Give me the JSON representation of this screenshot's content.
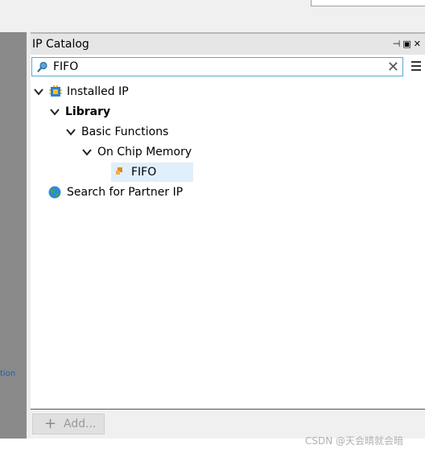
{
  "panel": {
    "title": "IP Catalog"
  },
  "search": {
    "value": "FIFO"
  },
  "tree": {
    "installed_ip": "Installed IP",
    "library": "Library",
    "basic_functions": "Basic Functions",
    "on_chip_memory": "On Chip Memory",
    "fifo": "FIFO",
    "partner_ip": "Search for Partner IP"
  },
  "left_panel": {
    "partial_text": "tion"
  },
  "bottom": {
    "add_label": "Add..."
  },
  "watermark": "CSDN @天会晴就会暗",
  "colors": {
    "selection": "#e1effb",
    "search_border": "#5aa6d6",
    "link": "#1f5fa8"
  }
}
